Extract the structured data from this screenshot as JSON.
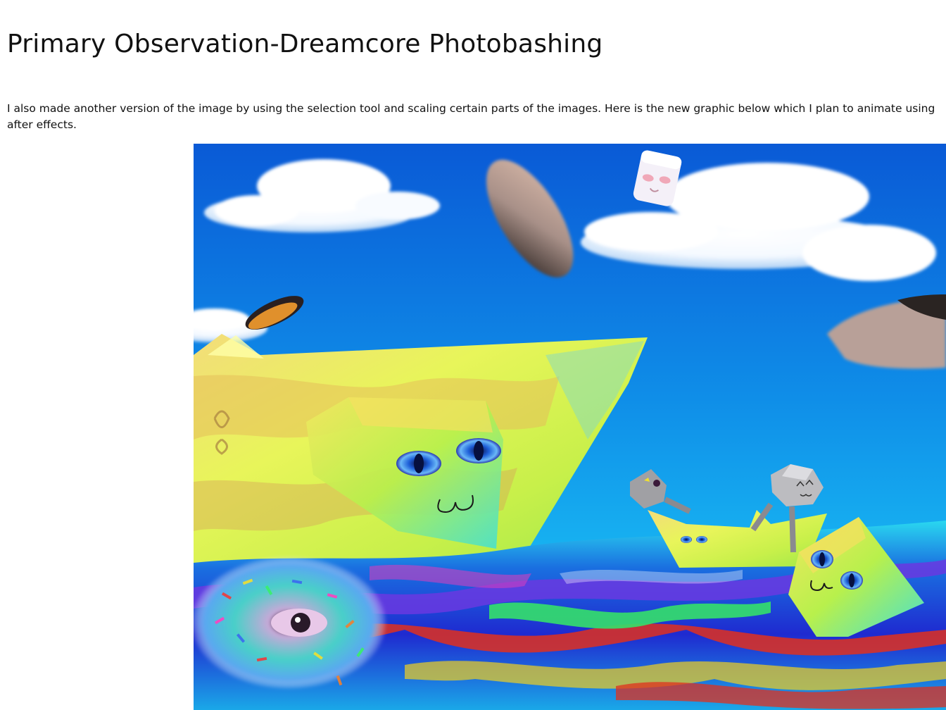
{
  "document": {
    "title": "Primary Observation-Dreamcore Photobashing",
    "paragraph": "I also made another version of the image by using the selection tool and scaling certain parts of the images. Here is the new graphic below which I plan to animate using after effects."
  },
  "artwork": {
    "description_icon": "dreamcore-collage-image",
    "colors": {
      "sky_top": "#0a5ed9",
      "sky_bottom": "#14a8f0",
      "boat_yellow": "#e8f55a",
      "boat_orange": "#f2c463",
      "water_blue": "#1b2bd6",
      "water_red": "#e0301e",
      "water_green": "#35e06a"
    }
  }
}
